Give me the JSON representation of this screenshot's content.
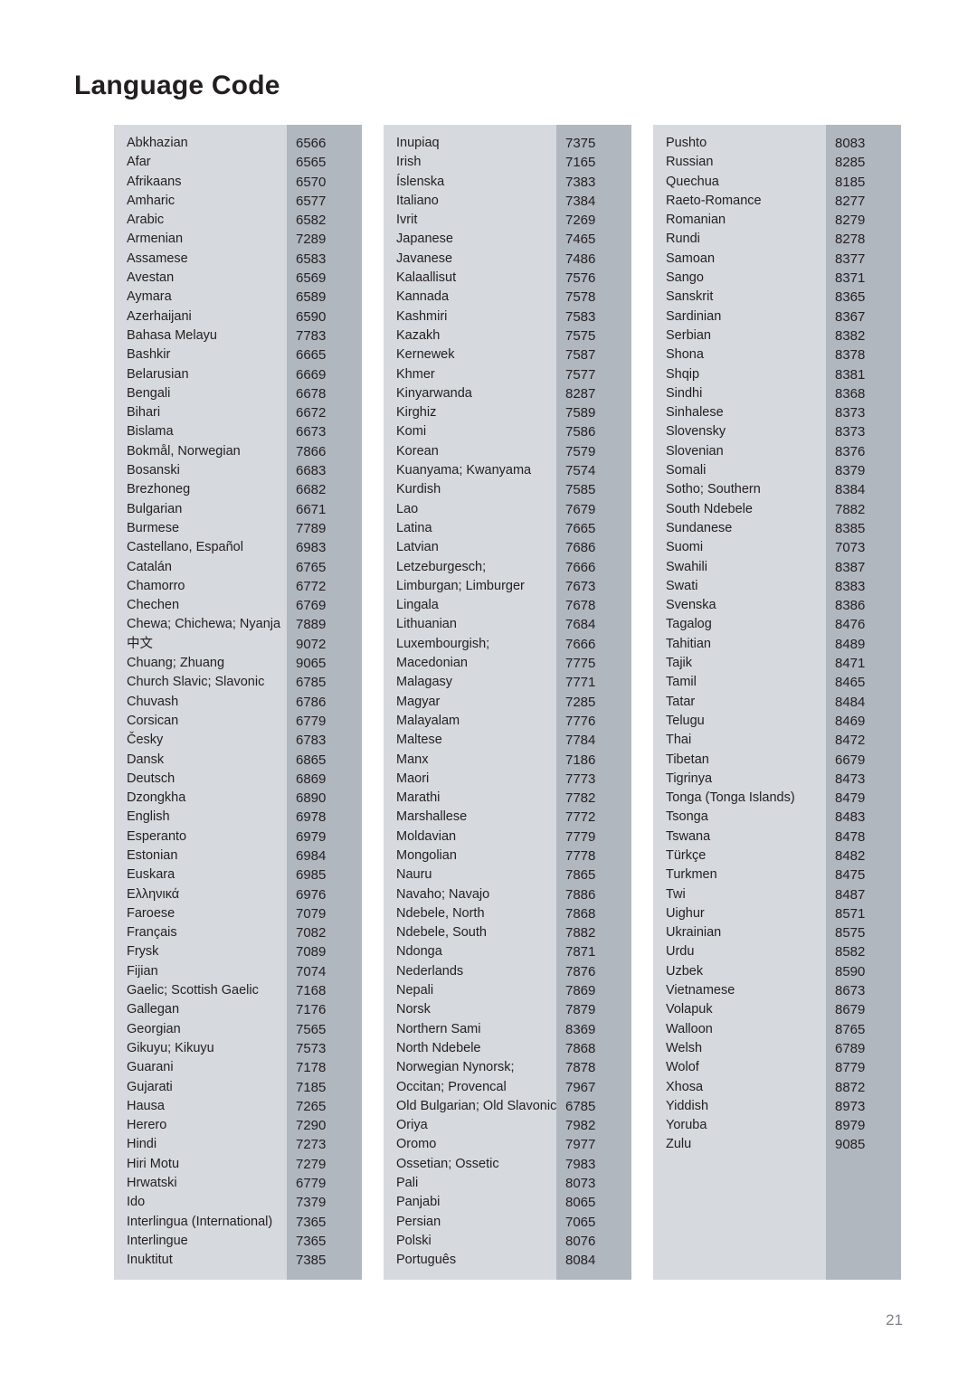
{
  "page": {
    "title": "Language Code",
    "number": "21",
    "colors": {
      "name_column_bg": "#d6d9de",
      "code_column_bg": "#b1b7bf",
      "text": "#231f20",
      "page_number": "#808388"
    }
  },
  "columns": [
    {
      "id": "column-1",
      "rows": [
        {
          "language": "Abkhazian",
          "code": "6566"
        },
        {
          "language": "Afar",
          "code": "6565"
        },
        {
          "language": "Afrikaans",
          "code": "6570"
        },
        {
          "language": "Amharic",
          "code": "6577"
        },
        {
          "language": "Arabic",
          "code": "6582"
        },
        {
          "language": "Armenian",
          "code": "7289"
        },
        {
          "language": "Assamese",
          "code": "6583"
        },
        {
          "language": "Avestan",
          "code": "6569"
        },
        {
          "language": "Aymara",
          "code": "6589"
        },
        {
          "language": "Azerhaijani",
          "code": "6590"
        },
        {
          "language": "Bahasa Melayu",
          "code": "7783"
        },
        {
          "language": "Bashkir",
          "code": "6665"
        },
        {
          "language": "Belarusian",
          "code": "6669"
        },
        {
          "language": "Bengali",
          "code": "6678"
        },
        {
          "language": "Bihari",
          "code": "6672"
        },
        {
          "language": "Bislama",
          "code": "6673"
        },
        {
          "language": "Bokmål, Norwegian",
          "code": "7866"
        },
        {
          "language": "Bosanski",
          "code": "6683"
        },
        {
          "language": "Brezhoneg",
          "code": "6682"
        },
        {
          "language": "Bulgarian",
          "code": "6671"
        },
        {
          "language": "Burmese",
          "code": "7789"
        },
        {
          "language": "Castellano, Español",
          "code": "6983"
        },
        {
          "language": "Catalán",
          "code": "6765"
        },
        {
          "language": "Chamorro",
          "code": "6772"
        },
        {
          "language": "Chechen",
          "code": "6769"
        },
        {
          "language": "Chewa; Chichewa; Nyanja",
          "code": "7889"
        },
        {
          "language": "中文",
          "code": "9072"
        },
        {
          "language": "Chuang; Zhuang",
          "code": "9065"
        },
        {
          "language": "Church Slavic; Slavonic",
          "code": "6785"
        },
        {
          "language": "Chuvash",
          "code": "6786"
        },
        {
          "language": "Corsican",
          "code": "6779"
        },
        {
          "language": "Česky",
          "code": "6783"
        },
        {
          "language": "Dansk",
          "code": "6865"
        },
        {
          "language": "Deutsch",
          "code": "6869"
        },
        {
          "language": "Dzongkha",
          "code": "6890"
        },
        {
          "language": "English",
          "code": "6978"
        },
        {
          "language": "Esperanto",
          "code": "6979"
        },
        {
          "language": "Estonian",
          "code": "6984"
        },
        {
          "language": "Euskara",
          "code": "6985"
        },
        {
          "language": "Ελληνικά",
          "code": "6976"
        },
        {
          "language": "Faroese",
          "code": "7079"
        },
        {
          "language": "Français",
          "code": "7082"
        },
        {
          "language": "Frysk",
          "code": "7089"
        },
        {
          "language": "Fijian",
          "code": "7074"
        },
        {
          "language": "Gaelic; Scottish Gaelic",
          "code": "7168"
        },
        {
          "language": "Gallegan",
          "code": "7176"
        },
        {
          "language": "Georgian",
          "code": "7565"
        },
        {
          "language": "Gikuyu; Kikuyu",
          "code": "7573"
        },
        {
          "language": "Guarani",
          "code": "7178"
        },
        {
          "language": "Gujarati",
          "code": "7185"
        },
        {
          "language": "Hausa",
          "code": "7265"
        },
        {
          "language": "Herero",
          "code": "7290"
        },
        {
          "language": "Hindi",
          "code": "7273"
        },
        {
          "language": "Hiri Motu",
          "code": "7279"
        },
        {
          "language": "Hrwatski",
          "code": "6779"
        },
        {
          "language": "Ido",
          "code": "7379"
        },
        {
          "language": "Interlingua (International)",
          "code": "7365"
        },
        {
          "language": "Interlingue",
          "code": "7365"
        },
        {
          "language": "Inuktitut",
          "code": "7385"
        }
      ]
    },
    {
      "id": "column-2",
      "rows": [
        {
          "language": "Inupiaq",
          "code": "7375"
        },
        {
          "language": "Irish",
          "code": "7165"
        },
        {
          "language": "Íslenska",
          "code": "7383"
        },
        {
          "language": "Italiano",
          "code": "7384"
        },
        {
          "language": "Ivrit",
          "code": "7269"
        },
        {
          "language": "Japanese",
          "code": "7465"
        },
        {
          "language": "Javanese",
          "code": "7486"
        },
        {
          "language": "Kalaallisut",
          "code": "7576"
        },
        {
          "language": "Kannada",
          "code": "7578"
        },
        {
          "language": "Kashmiri",
          "code": "7583"
        },
        {
          "language": "Kazakh",
          "code": "7575"
        },
        {
          "language": "Kernewek",
          "code": "7587"
        },
        {
          "language": "Khmer",
          "code": "7577"
        },
        {
          "language": "Kinyarwanda",
          "code": "8287"
        },
        {
          "language": "Kirghiz",
          "code": "7589"
        },
        {
          "language": "Komi",
          "code": "7586"
        },
        {
          "language": "Korean",
          "code": "7579"
        },
        {
          "language": "Kuanyama; Kwanyama",
          "code": "7574"
        },
        {
          "language": "Kurdish",
          "code": "7585"
        },
        {
          "language": "Lao",
          "code": "7679"
        },
        {
          "language": "Latina",
          "code": "7665"
        },
        {
          "language": "Latvian",
          "code": "7686"
        },
        {
          "language": "Letzeburgesch;",
          "code": "7666"
        },
        {
          "language": "Limburgan; Limburger",
          "code": "7673"
        },
        {
          "language": "Lingala",
          "code": "7678"
        },
        {
          "language": "Lithuanian",
          "code": "7684"
        },
        {
          "language": "Luxembourgish;",
          "code": "7666"
        },
        {
          "language": "Macedonian",
          "code": "7775"
        },
        {
          "language": "Malagasy",
          "code": "7771"
        },
        {
          "language": "Magyar",
          "code": "7285"
        },
        {
          "language": "Malayalam",
          "code": "7776"
        },
        {
          "language": "Maltese",
          "code": "7784"
        },
        {
          "language": "Manx",
          "code": "7186"
        },
        {
          "language": "Maori",
          "code": "7773"
        },
        {
          "language": "Marathi",
          "code": "7782"
        },
        {
          "language": "Marshallese",
          "code": "7772"
        },
        {
          "language": "Moldavian",
          "code": "7779"
        },
        {
          "language": "Mongolian",
          "code": "7778"
        },
        {
          "language": "Nauru",
          "code": "7865"
        },
        {
          "language": "Navaho; Navajo",
          "code": "7886"
        },
        {
          "language": "Ndebele, North",
          "code": "7868"
        },
        {
          "language": "Ndebele, South",
          "code": "7882"
        },
        {
          "language": "Ndonga",
          "code": "7871"
        },
        {
          "language": "Nederlands",
          "code": "7876"
        },
        {
          "language": "Nepali",
          "code": "7869"
        },
        {
          "language": "Norsk",
          "code": "7879"
        },
        {
          "language": "Northern Sami",
          "code": "8369"
        },
        {
          "language": "North Ndebele",
          "code": "7868"
        },
        {
          "language": "Norwegian Nynorsk;",
          "code": "7878"
        },
        {
          "language": "Occitan; Provencal",
          "code": "7967"
        },
        {
          "language": "Old Bulgarian; Old Slavonic",
          "code": "6785"
        },
        {
          "language": "Oriya",
          "code": "7982"
        },
        {
          "language": "Oromo",
          "code": "7977"
        },
        {
          "language": "Ossetian; Ossetic",
          "code": "7983"
        },
        {
          "language": "Pali",
          "code": "8073"
        },
        {
          "language": "Panjabi",
          "code": "8065"
        },
        {
          "language": "Persian",
          "code": "7065"
        },
        {
          "language": "Polski",
          "code": "8076"
        },
        {
          "language": "Português",
          "code": "8084"
        }
      ]
    },
    {
      "id": "column-3",
      "rows": [
        {
          "language": "Pushto",
          "code": "8083"
        },
        {
          "language": "Russian",
          "code": "8285"
        },
        {
          "language": "Quechua",
          "code": "8185"
        },
        {
          "language": "Raeto-Romance",
          "code": "8277"
        },
        {
          "language": "Romanian",
          "code": "8279"
        },
        {
          "language": "Rundi",
          "code": "8278"
        },
        {
          "language": "Samoan",
          "code": "8377"
        },
        {
          "language": "Sango",
          "code": "8371"
        },
        {
          "language": "Sanskrit",
          "code": "8365"
        },
        {
          "language": "Sardinian",
          "code": "8367"
        },
        {
          "language": "Serbian",
          "code": "8382"
        },
        {
          "language": "Shona",
          "code": "8378"
        },
        {
          "language": "Shqip",
          "code": "8381"
        },
        {
          "language": "Sindhi",
          "code": "8368"
        },
        {
          "language": "Sinhalese",
          "code": "8373"
        },
        {
          "language": "Slovensky",
          "code": "8373"
        },
        {
          "language": "Slovenian",
          "code": "8376"
        },
        {
          "language": "Somali",
          "code": "8379"
        },
        {
          "language": "Sotho; Southern",
          "code": "8384"
        },
        {
          "language": "South Ndebele",
          "code": "7882"
        },
        {
          "language": "Sundanese",
          "code": "8385"
        },
        {
          "language": "Suomi",
          "code": "7073"
        },
        {
          "language": "Swahili",
          "code": "8387"
        },
        {
          "language": "Swati",
          "code": "8383"
        },
        {
          "language": "Svenska",
          "code": "8386"
        },
        {
          "language": "Tagalog",
          "code": "8476"
        },
        {
          "language": "Tahitian",
          "code": "8489"
        },
        {
          "language": "Tajik",
          "code": "8471"
        },
        {
          "language": "Tamil",
          "code": "8465"
        },
        {
          "language": "Tatar",
          "code": "8484"
        },
        {
          "language": "Telugu",
          "code": "8469"
        },
        {
          "language": "Thai",
          "code": "8472"
        },
        {
          "language": "Tibetan",
          "code": "6679"
        },
        {
          "language": "Tigrinya",
          "code": "8473"
        },
        {
          "language": "Tonga (Tonga Islands)",
          "code": "8479"
        },
        {
          "language": "Tsonga",
          "code": "8483"
        },
        {
          "language": "Tswana",
          "code": "8478"
        },
        {
          "language": "Türkçe",
          "code": "8482"
        },
        {
          "language": "Turkmen",
          "code": "8475"
        },
        {
          "language": "Twi",
          "code": "8487"
        },
        {
          "language": "Uighur",
          "code": "8571"
        },
        {
          "language": "Ukrainian",
          "code": "8575"
        },
        {
          "language": "Urdu",
          "code": "8582"
        },
        {
          "language": "Uzbek",
          "code": "8590"
        },
        {
          "language": "Vietnamese",
          "code": "8673"
        },
        {
          "language": "Volapuk",
          "code": "8679"
        },
        {
          "language": "Walloon",
          "code": "8765"
        },
        {
          "language": "Welsh",
          "code": "6789"
        },
        {
          "language": "Wolof",
          "code": "8779"
        },
        {
          "language": "Xhosa",
          "code": "8872"
        },
        {
          "language": "Yiddish",
          "code": "8973"
        },
        {
          "language": "Yoruba",
          "code": "8979"
        },
        {
          "language": "Zulu",
          "code": "9085"
        }
      ]
    }
  ]
}
